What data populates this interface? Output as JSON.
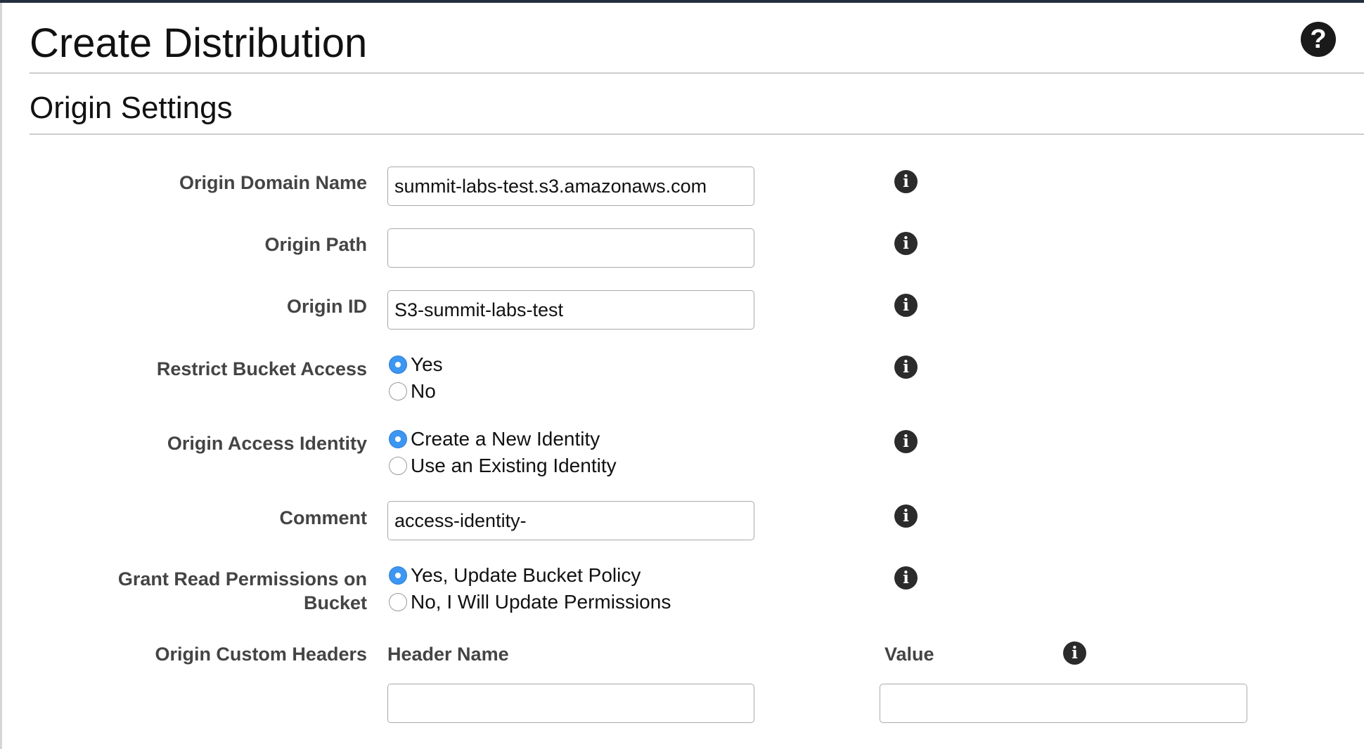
{
  "page": {
    "title": "Create Distribution",
    "help_icon": "question-mark-icon"
  },
  "origin_settings": {
    "title": "Origin Settings",
    "origin_domain_name": {
      "label": "Origin Domain Name",
      "value": "summit-labs-test.s3.amazonaws.com"
    },
    "origin_path": {
      "label": "Origin Path",
      "value": ""
    },
    "origin_id": {
      "label": "Origin ID",
      "value": "S3-summit-labs-test"
    },
    "restrict_bucket_access": {
      "label": "Restrict Bucket Access",
      "options": [
        "Yes",
        "No"
      ],
      "selected": "Yes"
    },
    "origin_access_identity": {
      "label": "Origin Access Identity",
      "options": [
        "Create a New Identity",
        "Use an Existing Identity"
      ],
      "selected": "Create a New Identity"
    },
    "comment": {
      "label": "Comment",
      "value": "access-identity-"
    },
    "grant_read_permissions": {
      "label_line1": "Grant Read Permissions on",
      "label_line2": "Bucket",
      "options": [
        "Yes, Update Bucket Policy",
        "No, I Will Update Permissions"
      ],
      "selected": "Yes, Update Bucket Policy"
    },
    "origin_custom_headers": {
      "label": "Origin Custom Headers",
      "header_name_label": "Header Name",
      "value_label": "Value",
      "header_name_value": "",
      "value_value": ""
    }
  },
  "icons": {
    "info": "info-icon",
    "radio_selected_color": "#3c96f2"
  }
}
